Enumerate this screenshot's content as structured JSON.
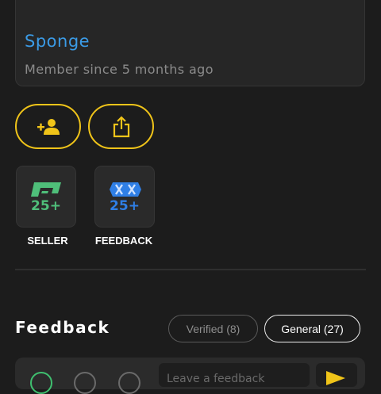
{
  "profile": {
    "username": "Sponge",
    "member_since": "Member since 5 months ago"
  },
  "actions": {
    "follow_icon": "person-add-icon",
    "share_icon": "share-icon"
  },
  "badges": [
    {
      "label": "SELLER",
      "count": "25+",
      "icon": "seller-badge-icon",
      "color": "#4fbf7a"
    },
    {
      "label": "FEEDBACK",
      "count": "25+",
      "icon": "feedback-badge-icon",
      "color": "#2f7fe6"
    }
  ],
  "feedback": {
    "title": "Feedback",
    "tabs": [
      {
        "label": "Verified (8)",
        "active": false
      },
      {
        "label": "General (27)",
        "active": true
      }
    ],
    "input_text": "Leave a feedback",
    "send_icon": "send-icon"
  },
  "colors": {
    "accent": "#f0c419",
    "link": "#3b9be6",
    "background": "#1c1c1c"
  }
}
